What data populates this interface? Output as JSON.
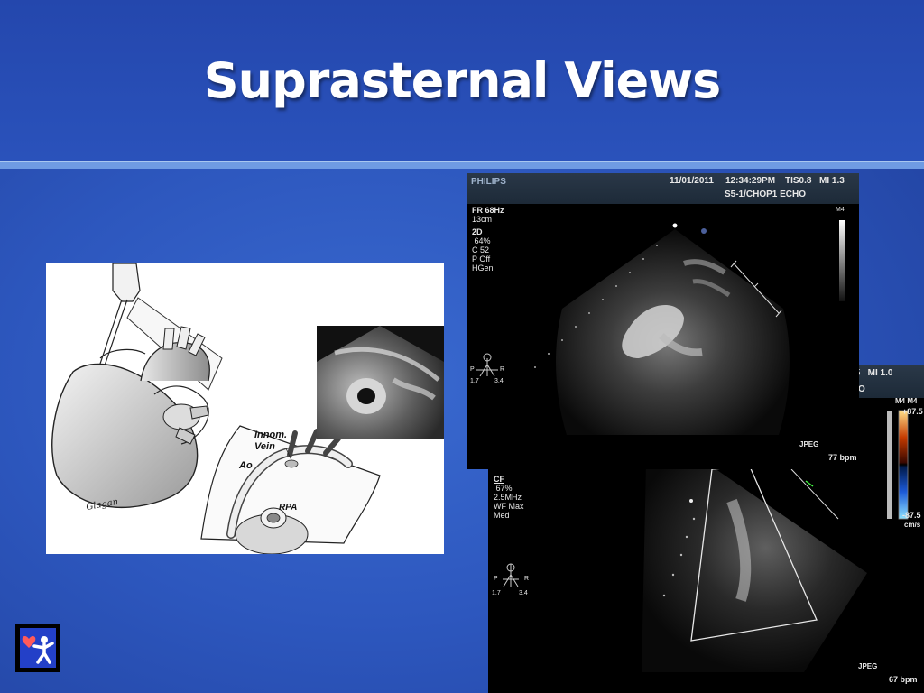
{
  "slide": {
    "title": "Suprasternal Views"
  },
  "diagram": {
    "labels": {
      "innom_vein_line1": "Innom.",
      "innom_vein_line2": "Vein",
      "ao": "Ao",
      "rpa": "RPA",
      "signature": "Glagan"
    }
  },
  "echo_top": {
    "brand": "PHILIPS",
    "date": "11/01/2011",
    "time": "12:34:29PM",
    "tis": "TIS0.8",
    "mi": "MI 1.3",
    "probe": "S5-1/CHOP1 ECHO",
    "fr": "FR 68Hz",
    "depth": "13cm",
    "mode": "2D",
    "gain": " 64%",
    "compress": "C 52",
    "persist": "P Off",
    "freq": "HGen",
    "scale_label": "M4",
    "orient_p": "P",
    "orient_r": "R",
    "orient_left": "1.7",
    "orient_right": "3.4",
    "format": "JPEG",
    "hr": "77 bpm"
  },
  "echo_bottom": {
    "header_partial": ".5   MI 1.0",
    "header_partial2": "O",
    "scale_label": "M4 M4",
    "scale_top": "+87.5",
    "scale_bottom": "-87.5",
    "scale_unit": "cm/s",
    "mode": "CF",
    "gain": " 67%",
    "freq": "2.5MHz",
    "filter": "WF Max",
    "level": "Med",
    "orient_p": "P",
    "orient_r": "R",
    "orient_left": "1.7",
    "orient_right": "3.4",
    "format": "JPEG",
    "hr": "67 bpm"
  }
}
